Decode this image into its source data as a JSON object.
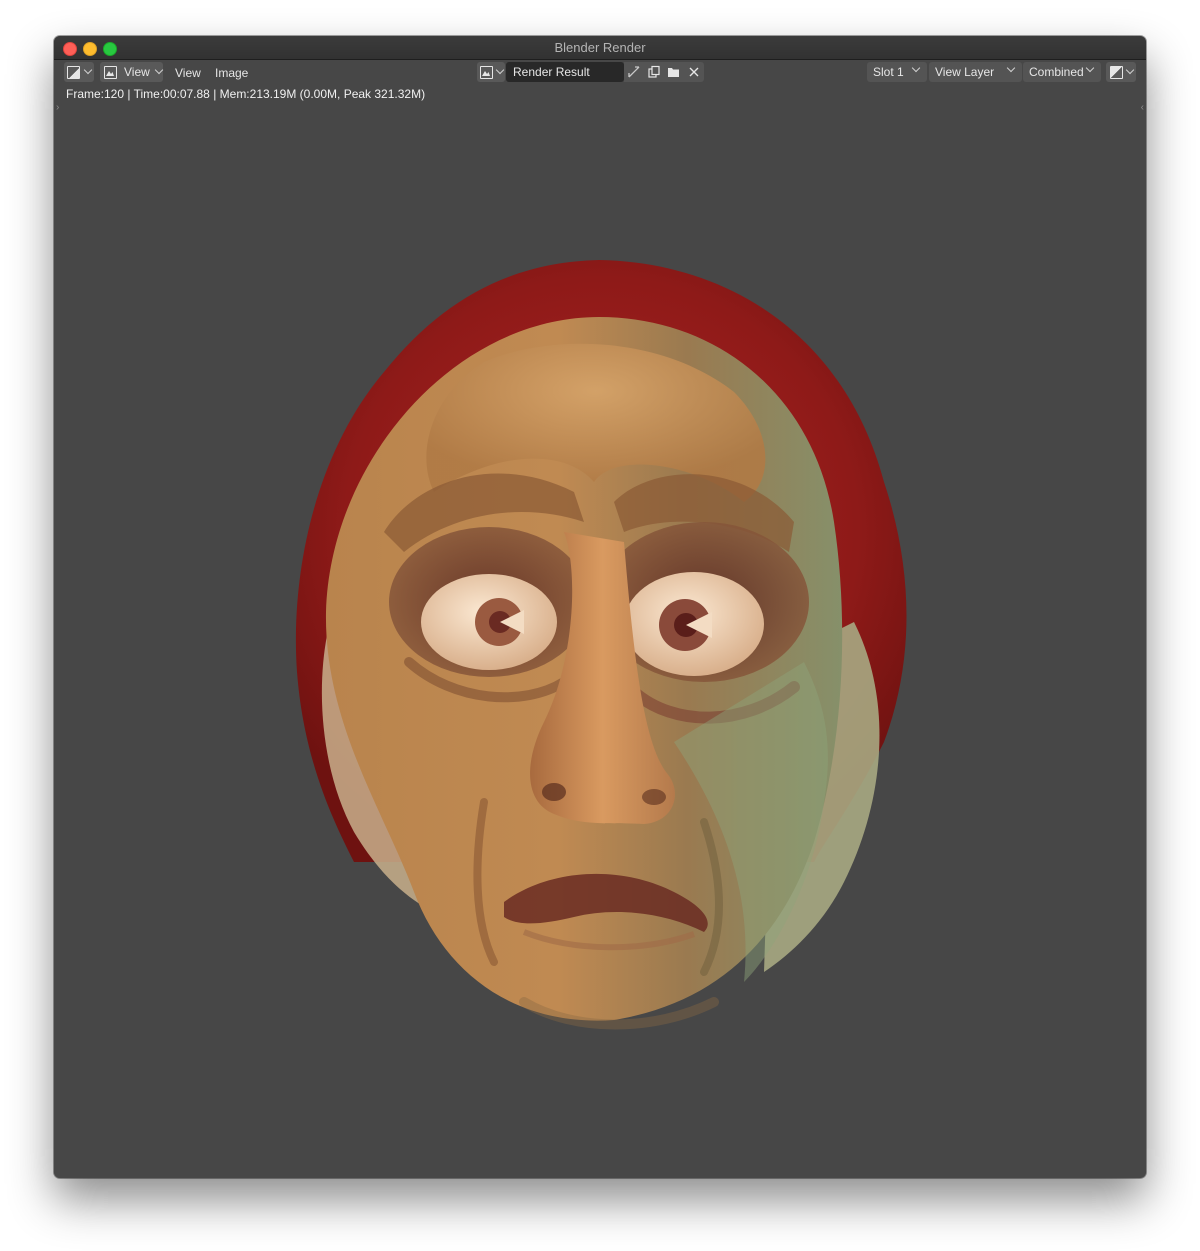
{
  "window": {
    "title": "Blender Render"
  },
  "header": {
    "editor_type_icon": "image-editor-icon",
    "view_menu_label": "View",
    "menus": [
      "View",
      "Image"
    ],
    "image_browse_icon": "image-browse-icon",
    "image_name": "Render Result",
    "slot": "Slot 1",
    "view_layer": "View Layer",
    "pass": "Combined",
    "display_channels_icon": "display-channels-icon"
  },
  "status": {
    "text": "Frame:120 | Time:00:07.88 | Mem:213.19M (0.00M, Peak 321.32M)"
  },
  "render": {
    "subject": "Render Result image",
    "colors": {
      "hood": "#8f1a1a",
      "skin": "#c2894f",
      "background": "#474747"
    }
  }
}
